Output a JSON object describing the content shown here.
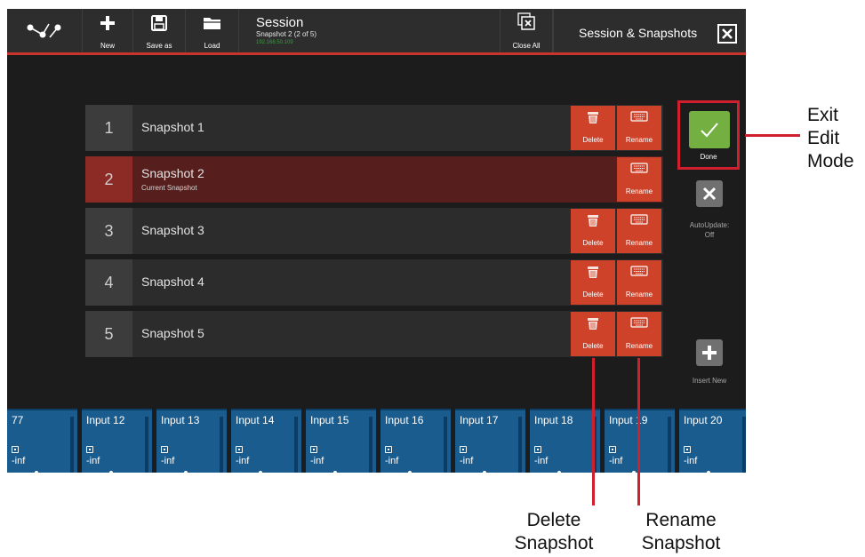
{
  "toolbar": {
    "new_label": "New",
    "save_as_label": "Save as",
    "load_label": "Load",
    "session_title": "Session",
    "session_subtitle": "Snapshot 2 (2 of 5)",
    "session_ip": "192.168.50.109",
    "close_all_label": "Close All",
    "panel_title": "Session & Snapshots"
  },
  "snapshots": [
    {
      "number": "1",
      "name": "Snapshot 1",
      "delete_label": "Delete",
      "rename_label": "Rename"
    },
    {
      "number": "2",
      "name": "Snapshot 2",
      "subtitle": "Current Snapshot",
      "rename_label": "Rename"
    },
    {
      "number": "3",
      "name": "Snapshot 3",
      "delete_label": "Delete",
      "rename_label": "Rename"
    },
    {
      "number": "4",
      "name": "Snapshot 4",
      "delete_label": "Delete",
      "rename_label": "Rename"
    },
    {
      "number": "5",
      "name": "Snapshot 5",
      "delete_label": "Delete",
      "rename_label": "Rename"
    }
  ],
  "side": {
    "done_label": "Done",
    "autoupdate_label": "AutoUpdate:",
    "autoupdate_state": "Off",
    "insert_label": "Insert New"
  },
  "channels": [
    {
      "name": "77",
      "level": "-inf"
    },
    {
      "name": "Input 12",
      "level": "-inf"
    },
    {
      "name": "Input 13",
      "level": "-inf"
    },
    {
      "name": "Input 14",
      "level": "-inf"
    },
    {
      "name": "Input 15",
      "level": "-inf"
    },
    {
      "name": "Input 16",
      "level": "-inf"
    },
    {
      "name": "Input 17",
      "level": "-inf"
    },
    {
      "name": "Input 18",
      "level": "-inf"
    },
    {
      "name": "Input 19",
      "level": "-inf"
    },
    {
      "name": "Input 20",
      "level": "-inf"
    }
  ],
  "annotations": {
    "exit_line1": "Exit",
    "exit_line2": "Edit",
    "exit_line3": "Mode",
    "delete_line1": "Delete",
    "delete_line2": "Snapshot",
    "rename_line1": "Rename",
    "rename_line2": "Snapshot"
  },
  "colors": {
    "accent_red": "#c8342c",
    "action_button": "#ce4229",
    "done_green": "#74b041",
    "channel_blue": "#1b5c8f",
    "annotation_red": "#d0202e"
  }
}
